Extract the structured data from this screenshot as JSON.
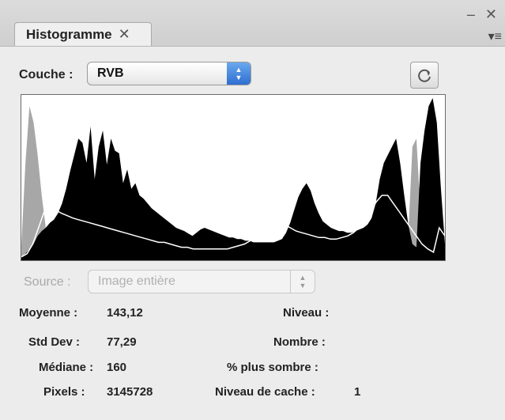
{
  "panel": {
    "tab_label": "Histogramme",
    "tab_close": "✕",
    "window_controls": "– ✕",
    "menu_icon": "▾≡"
  },
  "channel": {
    "label": "Couche :",
    "value": "RVB"
  },
  "source": {
    "label": "Source :",
    "value": "Image entière"
  },
  "stats": {
    "mean_label": "Moyenne :",
    "mean_value": "143,12",
    "stddev_label": "Std Dev :",
    "stddev_value": "77,29",
    "median_label": "Médiane :",
    "median_value": "160",
    "pixels_label": "Pixels :",
    "pixels_value": "3145728",
    "level_label": "Niveau :",
    "level_value": "",
    "count_label": "Nombre :",
    "count_value": "",
    "percentile_label": "% plus sombre :",
    "percentile_value": "",
    "cache_label": "Niveau de cache :",
    "cache_value": "1"
  },
  "histogram": {
    "black_channel": [
      4,
      8,
      14,
      20,
      30,
      36,
      40,
      46,
      50,
      58,
      70,
      88,
      110,
      130,
      150,
      145,
      120,
      165,
      100,
      140,
      160,
      118,
      150,
      135,
      132,
      95,
      112,
      88,
      95,
      80,
      76,
      70,
      64,
      60,
      56,
      52,
      48,
      44,
      40,
      38,
      36,
      33,
      30,
      34,
      38,
      40,
      38,
      36,
      34,
      32,
      30,
      28,
      28,
      26,
      26,
      24,
      24,
      22,
      22,
      22,
      22,
      22,
      22,
      24,
      26,
      34,
      46,
      62,
      78,
      88,
      95,
      86,
      70,
      58,
      48,
      44,
      40,
      38,
      36,
      36,
      34,
      34,
      36,
      38,
      40,
      44,
      52,
      70,
      100,
      120,
      130,
      140,
      150,
      120,
      80,
      44,
      20,
      16,
      120,
      160,
      190,
      200,
      170,
      90,
      20
    ],
    "grey_channel": [
      18,
      120,
      190,
      170,
      130,
      80,
      40,
      12,
      0,
      0,
      0,
      0,
      0,
      0,
      0,
      0,
      0,
      0,
      0,
      0,
      0,
      0,
      0,
      0,
      0,
      0,
      0,
      0,
      0,
      0,
      0,
      0,
      0,
      0,
      0,
      0,
      0,
      0,
      0,
      0,
      0,
      0,
      0,
      0,
      0,
      0,
      0,
      0,
      0,
      0,
      0,
      0,
      0,
      0,
      0,
      0,
      0,
      0,
      0,
      0,
      0,
      0,
      0,
      0,
      0,
      0,
      0,
      0,
      0,
      0,
      0,
      0,
      0,
      0,
      0,
      0,
      0,
      0,
      0,
      0,
      0,
      0,
      0,
      0,
      0,
      0,
      0,
      0,
      60,
      80,
      70,
      50,
      40,
      30,
      20,
      30,
      140,
      150,
      60,
      30,
      0,
      0,
      0,
      0,
      0
    ],
    "luminosity_line": [
      4,
      8,
      20,
      40,
      60,
      70,
      62,
      58,
      55,
      52,
      50,
      48,
      46,
      44,
      42,
      40,
      38,
      36,
      34,
      32,
      30,
      28,
      26,
      24,
      22,
      22,
      20,
      18,
      16,
      16,
      14,
      14,
      14,
      14,
      14,
      14,
      14,
      16,
      18,
      20,
      24,
      28,
      32,
      36,
      40,
      44,
      44,
      40,
      36,
      34,
      32,
      30,
      28,
      28,
      26,
      26,
      28,
      30,
      34,
      40,
      48,
      60,
      72,
      80,
      80,
      70,
      60,
      50,
      40,
      30,
      20,
      14,
      10,
      40,
      30
    ],
    "colors": {
      "black": "#000000",
      "grey": "#a7a7a7",
      "line": "#ffffff"
    }
  }
}
